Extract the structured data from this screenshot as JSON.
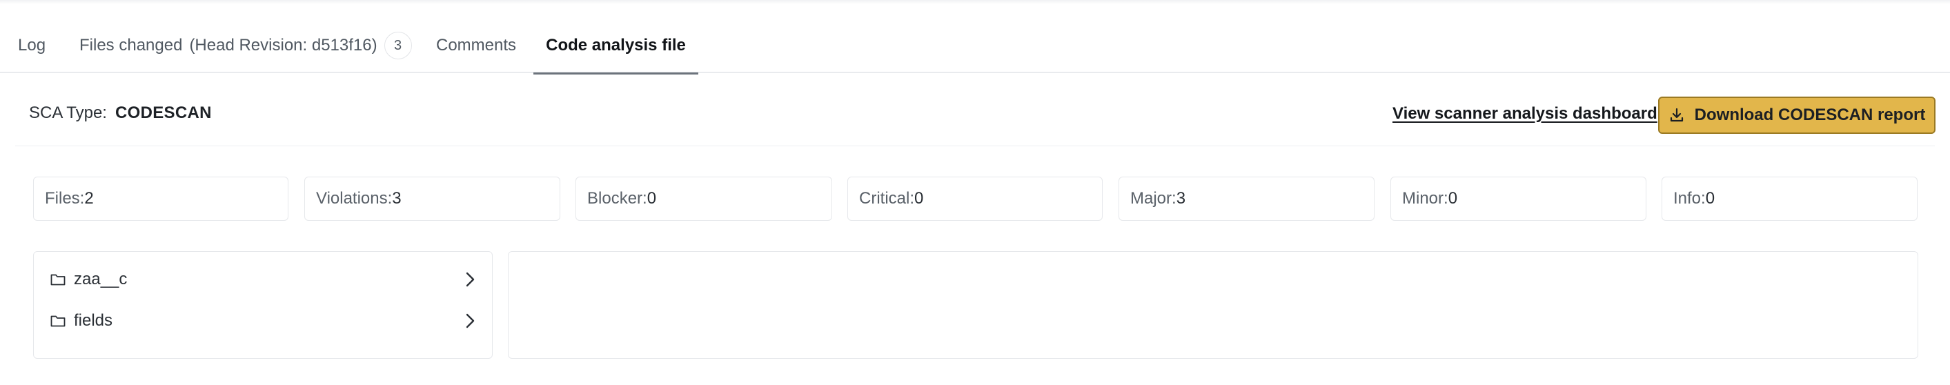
{
  "tabs": {
    "log": "Log",
    "files_changed": "Files changed",
    "head_revision": "(Head Revision: d513f16)",
    "files_count": "3",
    "comments": "Comments",
    "code_analysis": "Code analysis file",
    "active": "Code analysis file"
  },
  "sca": {
    "type_label": "SCA Type:",
    "type_value": "CODESCAN",
    "dashboard_link": "View scanner analysis dashboard",
    "download_button": "Download CODESCAN report",
    "accent_color": "#e2b64b"
  },
  "stats": [
    {
      "label": "Files:",
      "value": "2"
    },
    {
      "label": "Violations:",
      "value": "3"
    },
    {
      "label": "Blocker:",
      "value": "0"
    },
    {
      "label": "Critical:",
      "value": "0"
    },
    {
      "label": "Major:",
      "value": "3"
    },
    {
      "label": "Minor:",
      "value": "0"
    },
    {
      "label": "Info:",
      "value": "0"
    }
  ],
  "tree": {
    "items": [
      {
        "name": "zaa__c",
        "icon": "folder-icon"
      },
      {
        "name": "fields",
        "icon": "folder-icon"
      }
    ]
  }
}
